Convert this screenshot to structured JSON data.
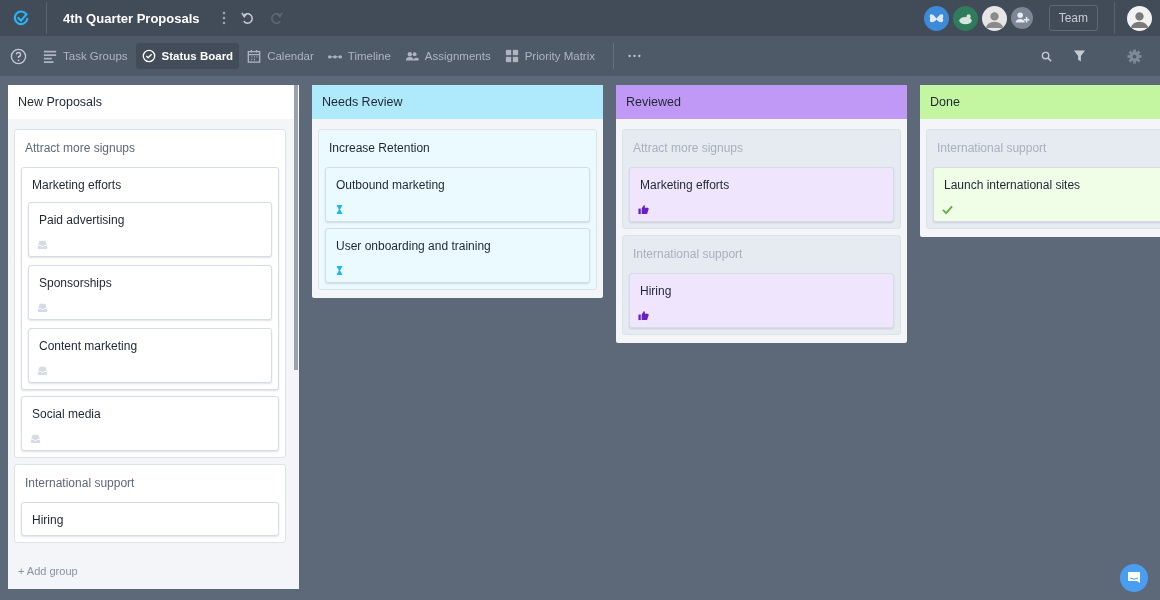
{
  "app": {
    "title": "4th Quarter Proposals",
    "team_button": "Team"
  },
  "toolbar": {
    "tabs": [
      {
        "label": "Task Groups",
        "kind": "list",
        "selected": false
      },
      {
        "label": "Status Board",
        "kind": "status",
        "selected": true
      },
      {
        "label": "Calendar",
        "kind": "calendar",
        "selected": false
      },
      {
        "label": "Timeline",
        "kind": "timeline",
        "selected": false
      },
      {
        "label": "Assignments",
        "kind": "people",
        "selected": false
      },
      {
        "label": "Priority Matrix",
        "kind": "matrix",
        "selected": false
      }
    ]
  },
  "board": {
    "columns": [
      {
        "title": "New Proposals",
        "color": "#ffffff",
        "footer": "+ Add group",
        "groups": [
          {
            "title": "Attract more signups",
            "kind": "owned",
            "tasks": [
              {
                "title": "Marketing efforts",
                "children": [
                  {
                    "title": "Paid advertising",
                    "kind": "inbox"
                  },
                  {
                    "title": "Sponsorships",
                    "kind": "inbox"
                  },
                  {
                    "title": "Content marketing",
                    "kind": "inbox"
                  }
                ]
              },
              {
                "title": "Social media",
                "kind": "inbox"
              }
            ]
          },
          {
            "title": "International support",
            "kind": "owned",
            "tasks": [
              {
                "title": "Hiring"
              }
            ]
          }
        ]
      },
      {
        "title": "Needs Review",
        "color": "#aeeafb",
        "groups": [
          {
            "title": "Increase Retention",
            "kind": "owned",
            "tasks": [
              {
                "title": "Outbound marketing",
                "kind": "pending"
              },
              {
                "title": "User onboarding and training",
                "kind": "pending"
              }
            ]
          }
        ]
      },
      {
        "title": "Reviewed",
        "color": "#bf99f5",
        "groups": [
          {
            "title": "Attract more signups",
            "kind": "context",
            "tasks": [
              {
                "title": "Marketing efforts",
                "kind": "approved"
              }
            ]
          },
          {
            "title": "International support",
            "kind": "context",
            "tasks": [
              {
                "title": "Hiring",
                "kind": "approved"
              }
            ]
          }
        ]
      },
      {
        "title": "Done",
        "color": "#c4f5a0",
        "groups": [
          {
            "title": "International support",
            "kind": "context",
            "tasks": [
              {
                "title": "Launch international sites",
                "kind": "done"
              }
            ]
          }
        ]
      }
    ]
  }
}
